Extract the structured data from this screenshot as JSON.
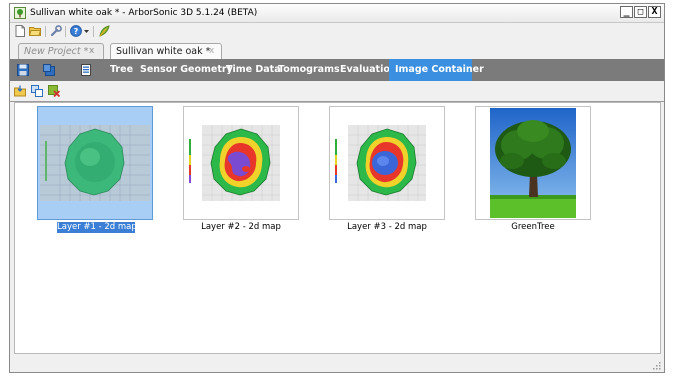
{
  "window": {
    "title": "Sullivan white oak * - ArborSonic 3D 5.1.24 (BETA)",
    "controls": {
      "minimize": "_",
      "maximize": "□",
      "close": "X"
    }
  },
  "toolbar": {
    "icons": [
      "new-document-icon",
      "open-folder-icon",
      "wrench-icon",
      "help-icon",
      "dropdown-arrow-icon",
      "leaf-icon"
    ]
  },
  "tabs": [
    {
      "label": "New Project *",
      "close": "x",
      "active": false
    },
    {
      "label": "Sullivan white oak *",
      "close": "x",
      "active": true
    }
  ],
  "nav": {
    "icons": [
      "save-icon",
      "save-as-icon",
      "report-icon"
    ],
    "items": [
      {
        "label": "Tree",
        "selected": false
      },
      {
        "label": "Sensor Geometry",
        "selected": false
      },
      {
        "label": "Time Data",
        "selected": false
      },
      {
        "label": "Tomograms",
        "selected": false
      },
      {
        "label": "Evaluation",
        "selected": false
      },
      {
        "label": "Image Container",
        "selected": true
      }
    ]
  },
  "image_toolbar": {
    "icons": [
      "import-image-icon",
      "copy-image-icon",
      "delete-image-icon"
    ]
  },
  "images": [
    {
      "label": "Layer #1 - 2d map",
      "selected": true
    },
    {
      "label": "Layer #2 - 2d map",
      "selected": false
    },
    {
      "label": "Layer #3 - 2d map",
      "selected": false
    },
    {
      "label": "GreenTree",
      "selected": false
    }
  ],
  "colors": {
    "nav_bg": "#7b7b7b",
    "nav_selected": "#3a8fe0",
    "selection_label": "#3a7fd5"
  }
}
